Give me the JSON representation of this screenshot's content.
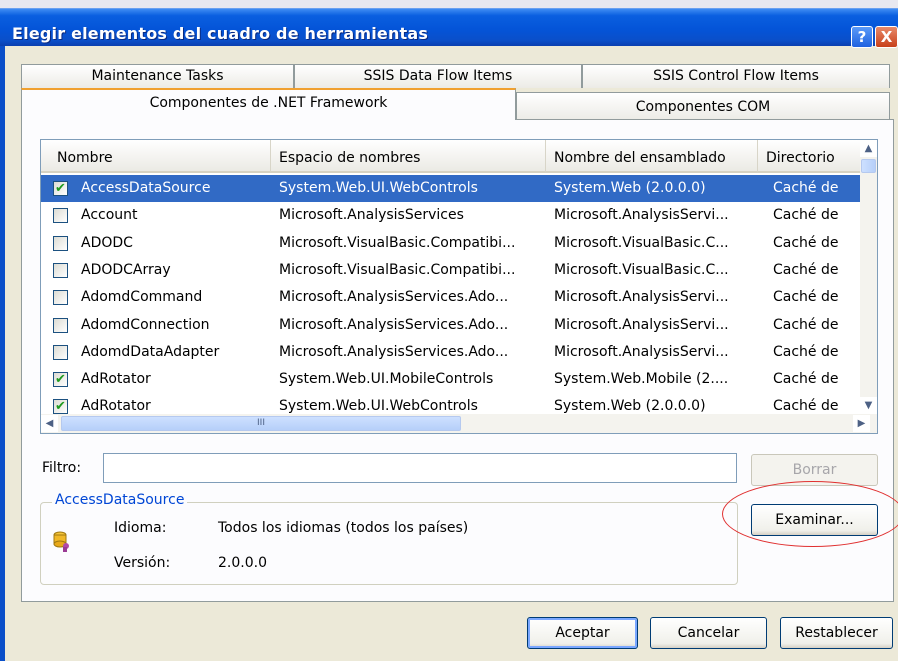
{
  "window": {
    "title": "Elegir elementos del cuadro de herramientas",
    "help_glyph": "?",
    "close_glyph": "X"
  },
  "tabs": {
    "maintenance": "Maintenance Tasks",
    "ssis_data_flow": "SSIS Data Flow Items",
    "ssis_control_flow": "SSIS Control Flow Items",
    "net_framework": "Componentes de .NET Framework",
    "com": "Componentes COM",
    "active": "Componentes de .NET Framework"
  },
  "list": {
    "columns": [
      "Nombre",
      "Espacio de nombres",
      "Nombre del ensamblado",
      "Directorio"
    ],
    "rows": [
      {
        "checked": true,
        "selected": true,
        "name": "AccessDataSource",
        "namespace": "System.Web.UI.WebControls",
        "assembly": "System.Web (2.0.0.0)",
        "directory": "Caché de"
      },
      {
        "checked": false,
        "selected": false,
        "name": "Account",
        "namespace": "Microsoft.AnalysisServices",
        "assembly": "Microsoft.AnalysisServi...",
        "directory": "Caché de"
      },
      {
        "checked": false,
        "selected": false,
        "name": "ADODC",
        "namespace": "Microsoft.VisualBasic.Compatibi...",
        "assembly": "Microsoft.VisualBasic.C...",
        "directory": "Caché de"
      },
      {
        "checked": false,
        "selected": false,
        "name": "ADODCArray",
        "namespace": "Microsoft.VisualBasic.Compatibi...",
        "assembly": "Microsoft.VisualBasic.C...",
        "directory": "Caché de"
      },
      {
        "checked": false,
        "selected": false,
        "name": "AdomdCommand",
        "namespace": "Microsoft.AnalysisServices.Ado...",
        "assembly": "Microsoft.AnalysisServi...",
        "directory": "Caché de"
      },
      {
        "checked": false,
        "selected": false,
        "name": "AdomdConnection",
        "namespace": "Microsoft.AnalysisServices.Ado...",
        "assembly": "Microsoft.AnalysisServi...",
        "directory": "Caché de"
      },
      {
        "checked": false,
        "selected": false,
        "name": "AdomdDataAdapter",
        "namespace": "Microsoft.AnalysisServices.Ado...",
        "assembly": "Microsoft.AnalysisServi...",
        "directory": "Caché de"
      },
      {
        "checked": true,
        "selected": false,
        "name": "AdRotator",
        "namespace": "System.Web.UI.MobileControls",
        "assembly": "System.Web.Mobile (2....",
        "directory": "Caché de"
      },
      {
        "checked": true,
        "selected": false,
        "name": "AdRotator",
        "namespace": "System.Web.UI.WebControls",
        "assembly": "System.Web (2.0.0.0)",
        "directory": "Caché de"
      }
    ],
    "check_glyph": "✔",
    "scroll_thumb_grip": "III"
  },
  "filter": {
    "label": "Filtro:",
    "value": "",
    "clear_label": "Borrar"
  },
  "details": {
    "group_title": "AccessDataSource",
    "language_label": "Idioma:",
    "language_value": "Todos los idiomas (todos los países)",
    "version_label": "Versión:",
    "version_value": "2.0.0.0",
    "icon": "component-icon"
  },
  "buttons": {
    "browse": "Examinar...",
    "ok": "Aceptar",
    "cancel": "Cancelar",
    "reset": "Restablecer"
  },
  "colors": {
    "selection": "#316ac5",
    "titlebar": "#0454d8",
    "annotation_ellipse": "#e03030",
    "group_title": "#0046d5"
  }
}
